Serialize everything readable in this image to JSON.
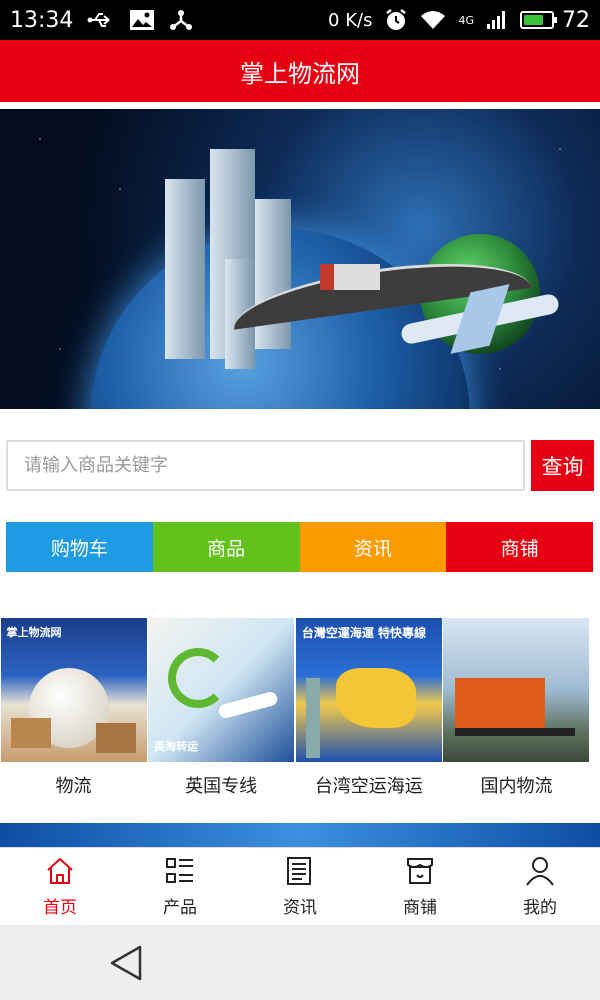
{
  "status_bar": {
    "time": "13:34",
    "net_speed": "0 K/s",
    "network_type": "4G",
    "battery": "72",
    "battery_fraction": 0.72,
    "icons": [
      "usb-icon",
      "image-icon",
      "share-icon",
      "alarm-icon",
      "wifi-icon",
      "signal-icon",
      "battery-icon"
    ]
  },
  "header": {
    "title": "掌上物流网"
  },
  "banner": {
    "slide_count": 4,
    "active_index": 2
  },
  "search": {
    "placeholder": "请输入商品关键字",
    "button_label": "查询"
  },
  "categories": [
    {
      "label": "购物车",
      "color": "#1e9be2"
    },
    {
      "label": "商品",
      "color": "#62c11a"
    },
    {
      "label": "资讯",
      "color": "#fb9b00"
    },
    {
      "label": "商铺",
      "color": "#e60012"
    }
  ],
  "products": [
    {
      "label": "物流",
      "image_text": "掌上物流网"
    },
    {
      "label": "英国专线",
      "image_text": "英淘转运"
    },
    {
      "label": "台湾空运海运",
      "image_text": "台灣空運海運 特快專線"
    },
    {
      "label": "国内物流",
      "image_text": ""
    }
  ],
  "bottom_nav": [
    {
      "label": "首页",
      "icon": "home-icon",
      "active": true
    },
    {
      "label": "产品",
      "icon": "list-icon",
      "active": false
    },
    {
      "label": "资讯",
      "icon": "news-icon",
      "active": false
    },
    {
      "label": "商铺",
      "icon": "shop-icon",
      "active": false
    },
    {
      "label": "我的",
      "icon": "user-icon",
      "active": false
    }
  ],
  "colors": {
    "brand": "#e60012",
    "nav_active": "#e60012"
  }
}
